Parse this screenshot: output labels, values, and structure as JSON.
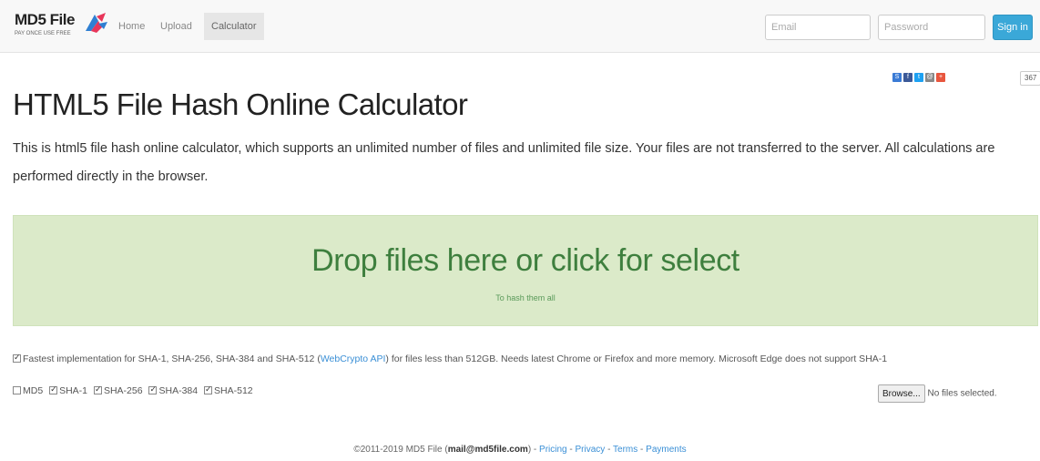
{
  "nav": {
    "brand_title": "MD5 File",
    "brand_tagline": "PAY ONCE USE FREE",
    "links": [
      "Home",
      "Upload",
      "Calculator"
    ],
    "active_link": "Calculator",
    "email_placeholder": "Email",
    "password_placeholder": "Password",
    "signin_label": "Sign in"
  },
  "share": {
    "buttons": [
      {
        "icon": "share-icon",
        "glyph": "S",
        "color": "#3a7bd5"
      },
      {
        "icon": "facebook-icon",
        "glyph": "f",
        "color": "#3b5998"
      },
      {
        "icon": "twitter-icon",
        "glyph": "t",
        "color": "#1da1f2"
      },
      {
        "icon": "email-icon",
        "glyph": "@",
        "color": "#888888"
      },
      {
        "icon": "plus-icon",
        "glyph": "+",
        "color": "#e8563e"
      }
    ],
    "count": "367"
  },
  "page": {
    "title": "HTML5 File Hash Online Calculator",
    "description": "This is html5 file hash online calculator, which supports an unlimited number of files and unlimited file size. Your files are not transferred to the server. All calculations are performed directly in the browser."
  },
  "dropzone": {
    "title": "Drop files here or click for select",
    "subtitle": "To hash them all"
  },
  "options": {
    "fastest_before": "Fastest implementation for SHA-1, SHA-256, SHA-384 and SHA-512 (",
    "fastest_link": "WebCrypto API",
    "fastest_after": ") for files less than 512GB. Needs latest Chrome or Firefox and more memory. Microsoft Edge does not support SHA-1",
    "fastest_checked": true,
    "algorithms": [
      {
        "label": "MD5",
        "checked": false
      },
      {
        "label": "SHA-1",
        "checked": true
      },
      {
        "label": "SHA-256",
        "checked": true
      },
      {
        "label": "SHA-384",
        "checked": true
      },
      {
        "label": "SHA-512",
        "checked": true
      }
    ]
  },
  "file_input": {
    "browse_label": "Browse...",
    "status": "No files selected."
  },
  "footer": {
    "copyright": "©2011-2019 MD5 File (",
    "email": "mail@md5file.com",
    "close": ") - ",
    "links": [
      "Pricing",
      "Privacy",
      "Terms",
      "Payments"
    ],
    "separator": " - "
  }
}
